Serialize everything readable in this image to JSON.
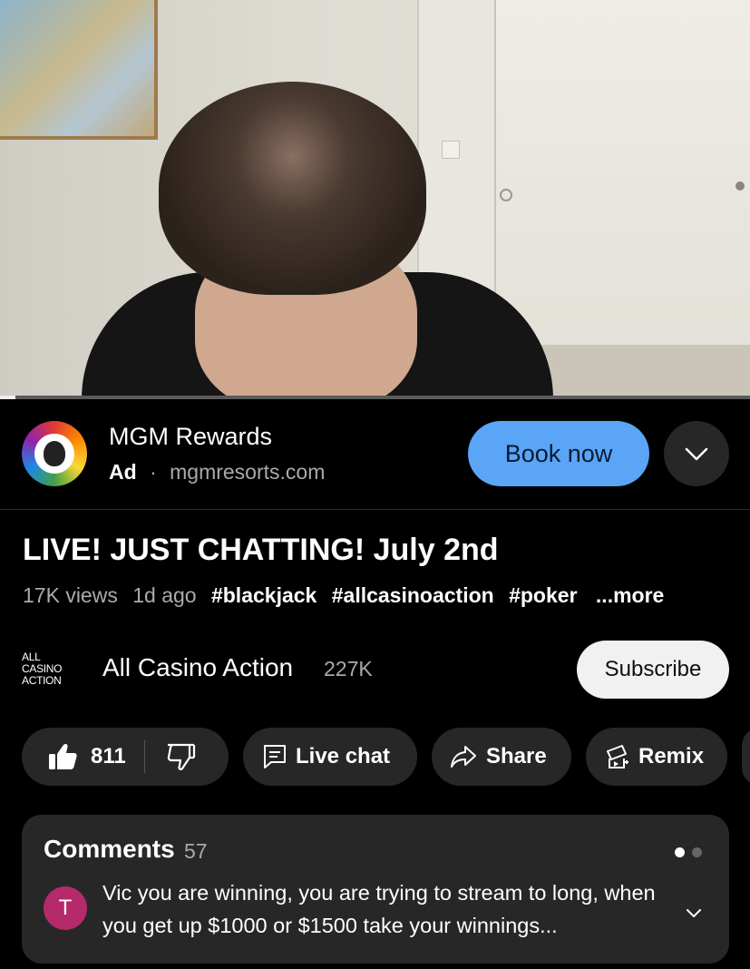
{
  "video": {
    "progress": 0.02
  },
  "ad": {
    "advertiser": "MGM Rewards",
    "badge": "Ad",
    "separator": "·",
    "domain": "mgmresorts.com",
    "cta": "Book now",
    "logo_icon": "mgm-lion-icon",
    "expand_icon": "chevron-down-icon"
  },
  "video_info": {
    "title": "LIVE! JUST CHATTING! July 2nd",
    "views": "17K views",
    "age": "1d ago",
    "hashtags": [
      "#blackjack",
      "#allcasinoaction",
      "#poker"
    ],
    "more": "...more"
  },
  "channel": {
    "logo_lines": [
      "ALL",
      "CASINO",
      "ACTION"
    ],
    "name": "All Casino Action",
    "subscribers": "227K",
    "subscribe_label": "Subscribe"
  },
  "actions": {
    "like_count": "811",
    "live_chat": "Live chat",
    "share": "Share",
    "remix": "Remix"
  },
  "comments": {
    "heading": "Comments",
    "count": "57",
    "top_comment": {
      "avatar_letter": "T",
      "avatar_color": "#b42a6b",
      "text": "Vic you are winning, you are trying to stream to long, when you get up $1000 or $1500 take your winnings..."
    }
  },
  "colors": {
    "cta_blue": "#5aa5f6",
    "pill_bg": "#272727",
    "background": "#000000"
  }
}
